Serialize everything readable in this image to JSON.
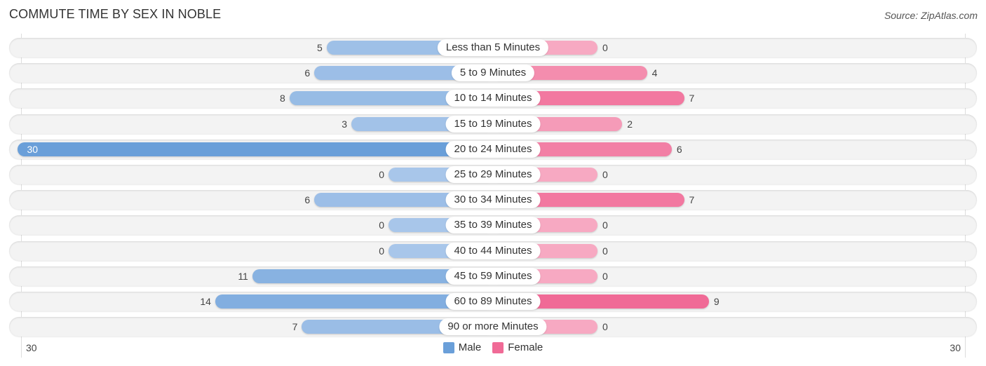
{
  "header": {
    "title": "COMMUTE TIME BY SEX IN NOBLE",
    "source": "Source: ZipAtlas.com"
  },
  "colors": {
    "male": "#6a9fd9",
    "male_light": "#a8c6ea",
    "female": "#f06a96",
    "female_light": "#f7a9c2"
  },
  "chart_data": {
    "type": "bar",
    "orientation": "horizontal-diverging",
    "title": "COMMUTE TIME BY SEX IN NOBLE",
    "categories": [
      "Less than 5 Minutes",
      "5 to 9 Minutes",
      "10 to 14 Minutes",
      "15 to 19 Minutes",
      "20 to 24 Minutes",
      "25 to 29 Minutes",
      "30 to 34 Minutes",
      "35 to 39 Minutes",
      "40 to 44 Minutes",
      "45 to 59 Minutes",
      "60 to 89 Minutes",
      "90 or more Minutes"
    ],
    "series": [
      {
        "name": "Male",
        "values": [
          5,
          6,
          8,
          3,
          30,
          0,
          6,
          0,
          0,
          11,
          14,
          7
        ]
      },
      {
        "name": "Female",
        "values": [
          0,
          4,
          7,
          2,
          6,
          0,
          7,
          0,
          0,
          0,
          9,
          0
        ]
      }
    ],
    "axis": {
      "left_max_label": "30",
      "right_max_label": "30",
      "range": [
        -30,
        30
      ]
    },
    "legend": {
      "position": "bottom-center",
      "entries": [
        "Male",
        "Female"
      ]
    },
    "grid": false
  }
}
